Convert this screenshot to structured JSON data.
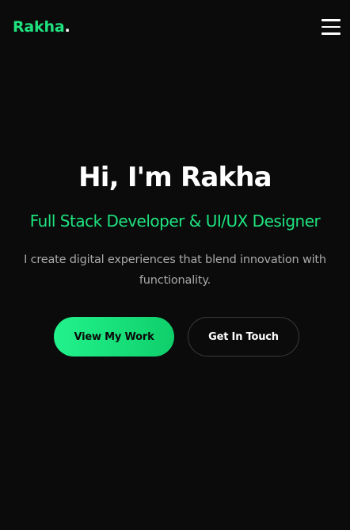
{
  "colors": {
    "background": "#0b0b0b",
    "accent": "#1ee37f",
    "text_primary": "#ffffff",
    "text_muted": "#a9a9a9"
  },
  "navbar": {
    "logo_text": "Rakha",
    "logo_dot": ".",
    "menu_icon": "hamburger-menu-icon"
  },
  "hero": {
    "title": "Hi, I'm Rakha",
    "subtitle": "Full Stack Developer & UI/UX Designer",
    "description": "I create digital experiences that blend innovation with functionality.",
    "primary_button_label": "View My Work",
    "secondary_button_label": "Get In Touch"
  }
}
